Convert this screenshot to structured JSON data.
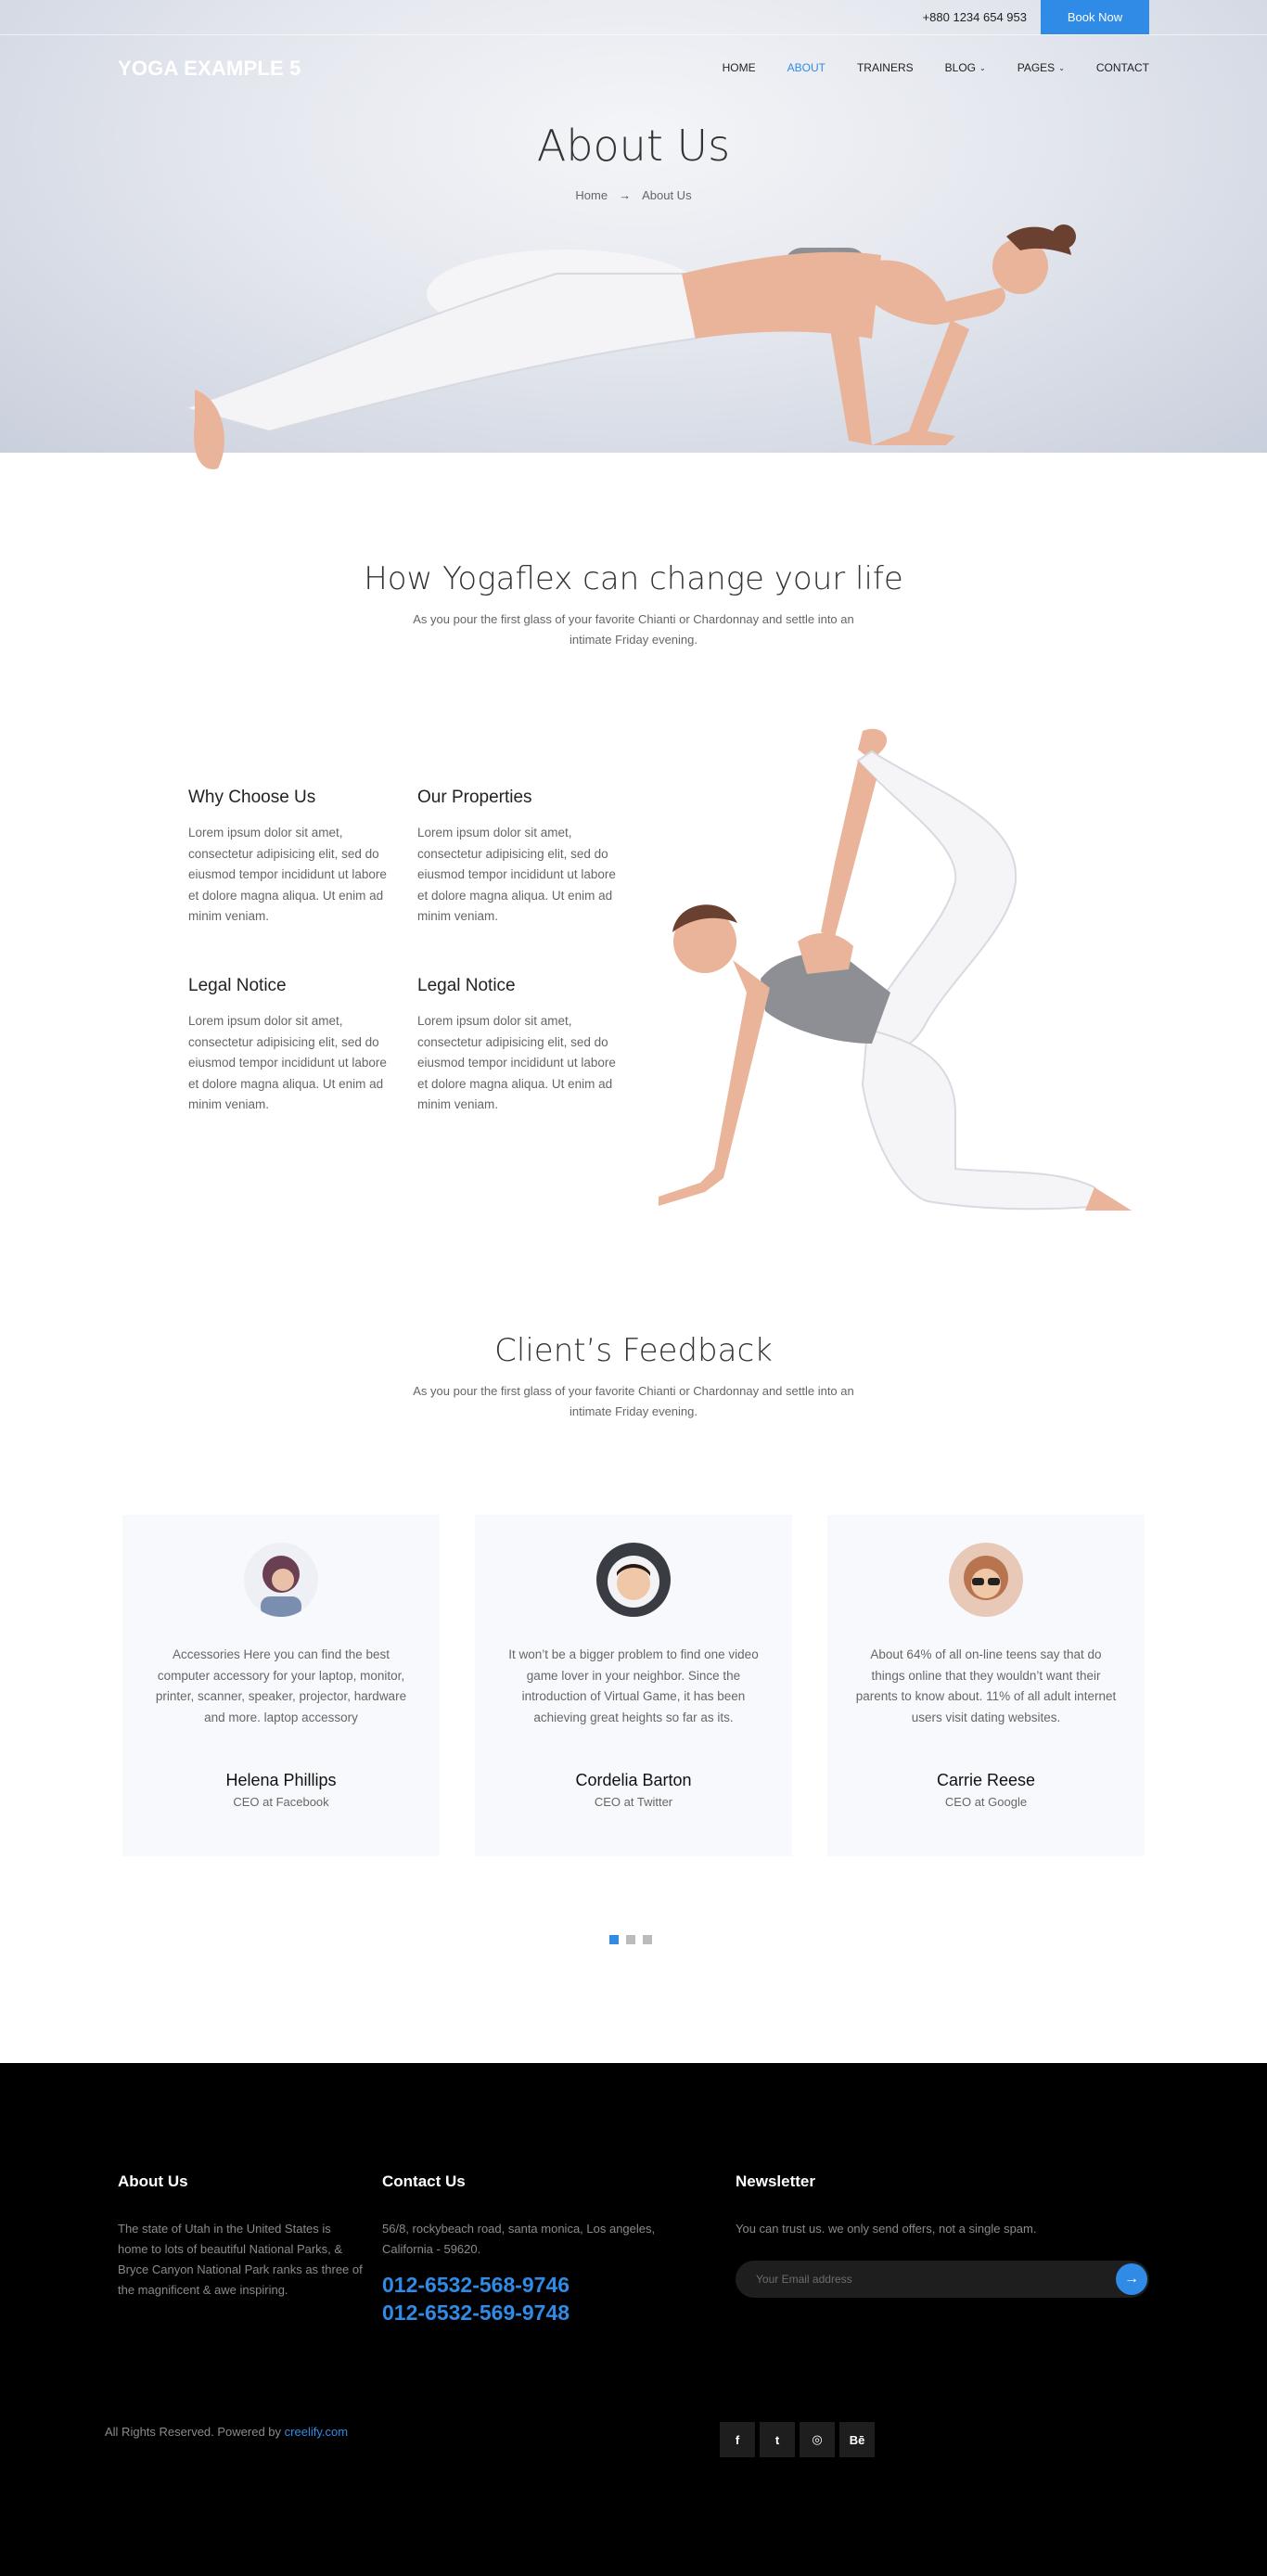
{
  "topbar": {
    "phone": "+880 1234 654 953",
    "book_label": "Book Now"
  },
  "brand": {
    "logo": "YOGA EXAMPLE 5"
  },
  "nav": [
    {
      "label": "HOME",
      "caret": ""
    },
    {
      "label": "ABOUT",
      "caret": ""
    },
    {
      "label": "TRAINERS",
      "caret": ""
    },
    {
      "label": "BLOG",
      "caret": "⌄"
    },
    {
      "label": "PAGES",
      "caret": "⌄"
    },
    {
      "label": "CONTACT",
      "caret": ""
    }
  ],
  "hero": {
    "title": "About Us",
    "crumb_home": "Home",
    "crumb_arrow": "→",
    "crumb_current": "About Us"
  },
  "intro": {
    "title": "How Yogaflex can change your life",
    "subtitle": "As you pour the first glass of your favorite Chianti or Chardonnay and settle into an intimate Friday evening."
  },
  "features": [
    {
      "title": "Why Choose Us",
      "text": "Lorem ipsum dolor sit amet, consectetur adipisicing elit, sed do eiusmod tempor incididunt ut labore et dolore magna aliqua. Ut enim ad minim veniam."
    },
    {
      "title": "Our Properties",
      "text": "Lorem ipsum dolor sit amet, consectetur adipisicing elit, sed do eiusmod tempor incididunt ut labore et dolore magna aliqua. Ut enim ad minim veniam."
    },
    {
      "title": "Legal Notice",
      "text": "Lorem ipsum dolor sit amet, consectetur adipisicing elit, sed do eiusmod tempor incididunt ut labore et dolore magna aliqua. Ut enim ad minim veniam."
    },
    {
      "title": "Legal Notice",
      "text": "Lorem ipsum dolor sit amet, consectetur adipisicing elit, sed do eiusmod tempor incididunt ut labore et dolore magna aliqua. Ut enim ad minim veniam."
    }
  ],
  "feedback": {
    "title": "Client’s Feedback",
    "subtitle": "As you pour the first glass of your favorite Chianti or Chardonnay and settle into an intimate Friday evening.",
    "items": [
      {
        "quote": "Accessories Here you can find the best computer accessory for your laptop, monitor, printer, scanner, speaker, projector, hardware and more. laptop accessory",
        "name": "Helena Phillips",
        "role": "CEO at Facebook"
      },
      {
        "quote": "It won’t be a bigger problem to find one video game lover in your neighbor. Since the introduction of Virtual Game, it has been achieving great heights so far as its.",
        "name": "Cordelia Barton",
        "role": "CEO at Twitter"
      },
      {
        "quote": "About 64% of all on-line teens say that do things online that they wouldn’t want their parents to know about. 11% of all adult internet users visit dating websites.",
        "name": "Carrie Reese",
        "role": "CEO at Google"
      }
    ]
  },
  "footer": {
    "about_title": "About Us",
    "about_text": "The state of Utah in the United States is home to lots of beautiful National Parks, & Bryce Canyon National Park ranks as three of the magnificent & awe inspiring.",
    "contact_title": "Contact Us",
    "contact_address": "56/8, rockybeach road, santa monica, Los angeles, California - 59620.",
    "phone_1": "012-6532-568-9746",
    "phone_2": "012-6532-569-9748",
    "newsletter_title": "Newsletter",
    "newsletter_text": "You can trust us. we only send offers, not a single spam.",
    "newsletter_placeholder": "Your Email address",
    "copyright_prefix": "All Rights Reserved. Powered by ",
    "copyright_link": "creelify.com",
    "social": [
      {
        "icon": "facebook-icon",
        "glyph": "f"
      },
      {
        "icon": "twitter-icon",
        "glyph": "t"
      },
      {
        "icon": "dribbble-icon",
        "glyph": "◎"
      },
      {
        "icon": "behance-icon",
        "glyph": "Bē"
      }
    ]
  },
  "colors": {
    "accent": "#2f8be6",
    "footer_bg": "#000000",
    "card_bg": "#f8f9fd"
  }
}
